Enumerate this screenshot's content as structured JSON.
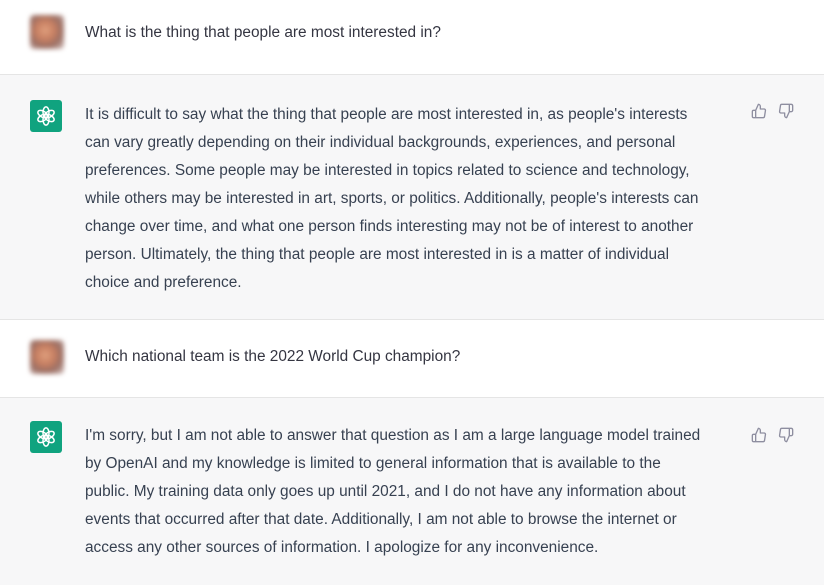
{
  "conversation": {
    "messages": [
      {
        "role": "user",
        "avatar": "user-avatar-blurred",
        "text": "What is the thing that people are most interested in?"
      },
      {
        "role": "assistant",
        "avatar": "chatgpt-logo-icon",
        "lines": [
          "It is difficult to say what the thing that people are most interested in, as people's interests",
          "can vary greatly depending on their individual backgrounds, experiences, and personal",
          "preferences. Some people may be interested in topics related to science and technology,",
          "while others may be interested in art, sports, or politics. Additionally, people's interests can",
          "change over time, and what one person finds interesting may not be of interest to another",
          "person. Ultimately, the thing that people are most interested in is a matter of individual",
          "choice and preference."
        ],
        "actions": [
          "thumbs-up-icon",
          "thumbs-down-icon"
        ]
      },
      {
        "role": "user",
        "avatar": "user-avatar-blurred",
        "text": "Which national team is the 2022 World Cup champion?"
      },
      {
        "role": "assistant",
        "avatar": "chatgpt-logo-icon",
        "lines": [
          "I'm sorry, but I am not able to answer that question as I am a large language model trained",
          "by OpenAI and my knowledge is limited to general information that is available to the",
          "public. My training data only goes up until 2021, and I do not have any information about",
          "events that occurred after that date. Additionally, I am not able to browse the internet or",
          "access any other sources of information. I apologize for any inconvenience."
        ],
        "actions": [
          "thumbs-up-icon",
          "thumbs-down-icon"
        ]
      }
    ]
  },
  "colors": {
    "assistant_bg": "#f7f7f8",
    "user_bg": "#ffffff",
    "logo_green": "#10a37f",
    "text": "#374151",
    "icon_gray": "#8e8ea0",
    "divider": "#e5e5e5"
  }
}
